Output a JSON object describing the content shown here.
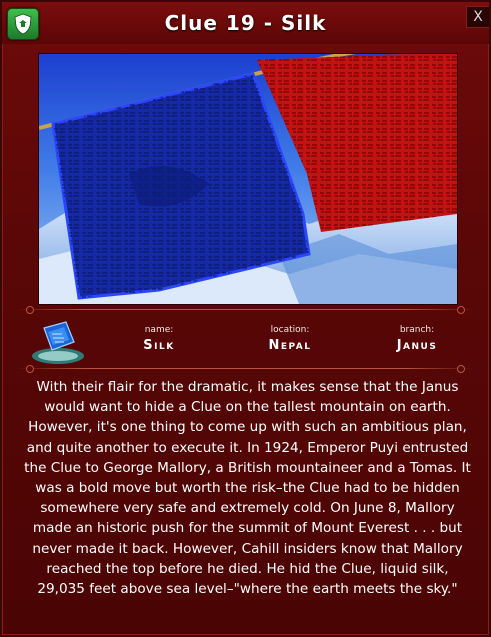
{
  "window": {
    "title": "Clue 19 - Silk",
    "close_label": "X"
  },
  "clue": {
    "name_label": "name:",
    "name_value": "Silk",
    "location_label": "location:",
    "location_value": "Nepal",
    "branch_label": "branch:",
    "branch_value": "Janus"
  },
  "description": "With their flair for the dramatic, it makes sense that the Janus would want to hide a Clue on the tallest mountain on earth. However, it's one thing to come up with such an ambitious plan, and quite another to execute it. In 1924, Emperor Puyi entrusted the Clue to George Mallory, a British mountaineer and a Tomas. It was a bold move but worth the risk–the Clue had to be hidden somewhere very safe and extremely cold. On June 8, Mallory made an historic push for the summit of Mount Everest . . . but never made it back. However, Cahill insiders know that Mallory reached the top before he died. He hid the Clue, liquid silk, 29,035 feet above sea level–\"where the earth meets the sky.\"",
  "icons": {
    "badge": "shield-icon",
    "item": "silk-crystal-icon"
  },
  "colors": {
    "panel": "#5a0707",
    "badge": "#2e9e3c",
    "blue_flag": "#1a2fa0",
    "red_flag": "#c01010"
  }
}
